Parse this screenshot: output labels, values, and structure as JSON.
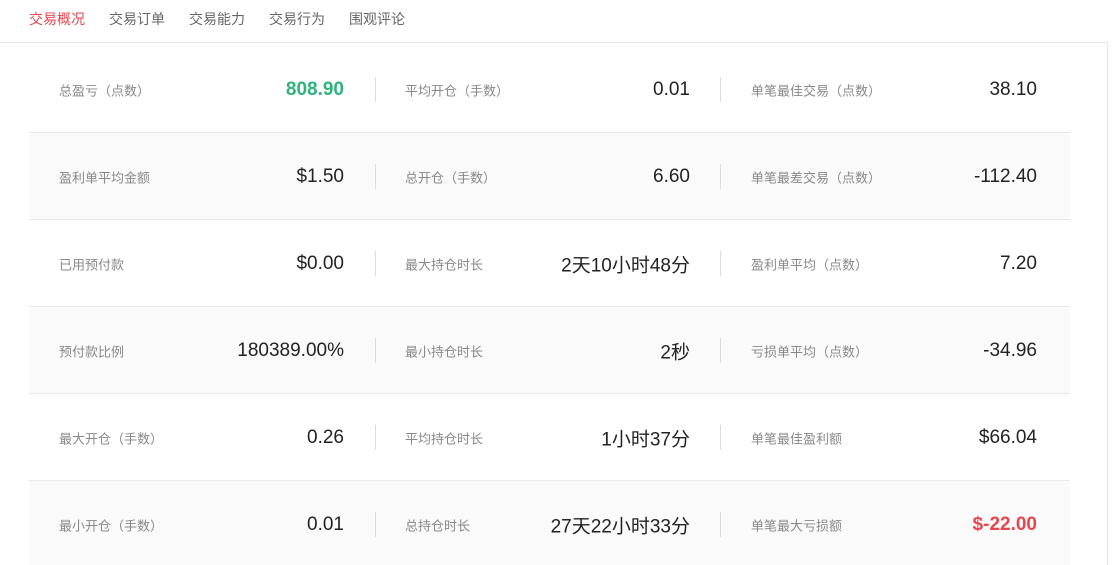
{
  "tabs": [
    {
      "label": "交易概况",
      "active": true
    },
    {
      "label": "交易订单",
      "active": false
    },
    {
      "label": "交易能力",
      "active": false
    },
    {
      "label": "交易行为",
      "active": false
    },
    {
      "label": "围观评论",
      "active": false
    }
  ],
  "colors": {
    "accent_red": "#e8464f",
    "profit_green": "#2fb37a"
  },
  "rows": [
    [
      {
        "label": "总盈亏（点数）",
        "value": "808.90",
        "tone": "green"
      },
      {
        "label": "平均开仓（手数）",
        "value": "0.01",
        "tone": ""
      },
      {
        "label": "单笔最佳交易（点数）",
        "value": "38.10",
        "tone": ""
      }
    ],
    [
      {
        "label": "盈利单平均金额",
        "value": "$1.50",
        "tone": ""
      },
      {
        "label": "总开仓（手数）",
        "value": "6.60",
        "tone": ""
      },
      {
        "label": "单笔最差交易（点数）",
        "value": "-112.40",
        "tone": ""
      }
    ],
    [
      {
        "label": "已用预付款",
        "value": "$0.00",
        "tone": ""
      },
      {
        "label": "最大持仓时长",
        "value": "2天10小时48分",
        "tone": ""
      },
      {
        "label": "盈利单平均（点数）",
        "value": "7.20",
        "tone": ""
      }
    ],
    [
      {
        "label": "预付款比例",
        "value": "180389.00%",
        "tone": ""
      },
      {
        "label": "最小持仓时长",
        "value": "2秒",
        "tone": ""
      },
      {
        "label": "亏损单平均（点数）",
        "value": "-34.96",
        "tone": ""
      }
    ],
    [
      {
        "label": "最大开仓（手数）",
        "value": "0.26",
        "tone": ""
      },
      {
        "label": "平均持仓时长",
        "value": "1小时37分",
        "tone": ""
      },
      {
        "label": "单笔最佳盈利额",
        "value": "$66.04",
        "tone": ""
      }
    ],
    [
      {
        "label": "最小开仓（手数）",
        "value": "0.01",
        "tone": ""
      },
      {
        "label": "总持仓时长",
        "value": "27天22小时33分",
        "tone": ""
      },
      {
        "label": "单笔最大亏损额",
        "value": "$-22.00",
        "tone": "red"
      }
    ]
  ]
}
